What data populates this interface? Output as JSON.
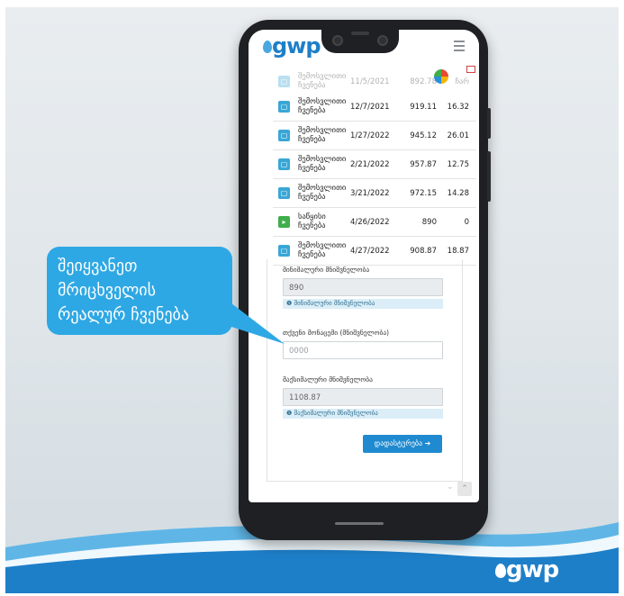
{
  "table_header": {
    "type": "შემოსვლითი ჩვენება",
    "date": "11/5/2021",
    "value": "892.78",
    "consumption": "ჩარ"
  },
  "rows": [
    {
      "type": "შემოსვლითი ჩვენება",
      "date": "12/7/2021",
      "value": "919.11",
      "consumption": "16.32",
      "icon": "document-icon"
    },
    {
      "type": "შემოსვლითი ჩვენება",
      "date": "1/27/2022",
      "value": "945.12",
      "consumption": "26.01",
      "icon": "document-icon"
    },
    {
      "type": "შემოსვლითი ჩვენება",
      "date": "2/21/2022",
      "value": "957.87",
      "consumption": "12.75",
      "icon": "document-icon"
    },
    {
      "type": "შემოსვლითი ჩვენება",
      "date": "3/21/2022",
      "value": "972.15",
      "consumption": "14.28",
      "icon": "document-icon"
    },
    {
      "type": "საწყისი ჩვენება",
      "date": "4/26/2022",
      "value": "890",
      "consumption": "0",
      "icon": "start-icon"
    },
    {
      "type": "შემოსვლითი ჩვენება",
      "date": "4/27/2022",
      "value": "908.87",
      "consumption": "18.87",
      "icon": "document-icon"
    }
  ],
  "form": {
    "min_label": "მინიმალური მნიშვნელობა",
    "min_value": "890",
    "min_hint": "მინიმალური მნიშვნელობა",
    "current_label": "თქვენი მონაცემი (მნიშვნელობა)",
    "current_placeholder": "0000",
    "max_label": "მაქსიმალური მნიშვნელობა",
    "max_value": "1108.87",
    "max_hint": "მაქსიმალური მნიშვნელობა",
    "submit_label": "დადასტურება ➔"
  },
  "callout": {
    "line1": "შეიყვანეთ",
    "line2": "მრიცხველის",
    "line3": "რეალურ ჩვენება"
  },
  "brand": {
    "logo": "gwp",
    "colors": {
      "accent": "#1f8ad0",
      "callout": "#2ea8e4",
      "wave": "#1e7fc9"
    }
  }
}
